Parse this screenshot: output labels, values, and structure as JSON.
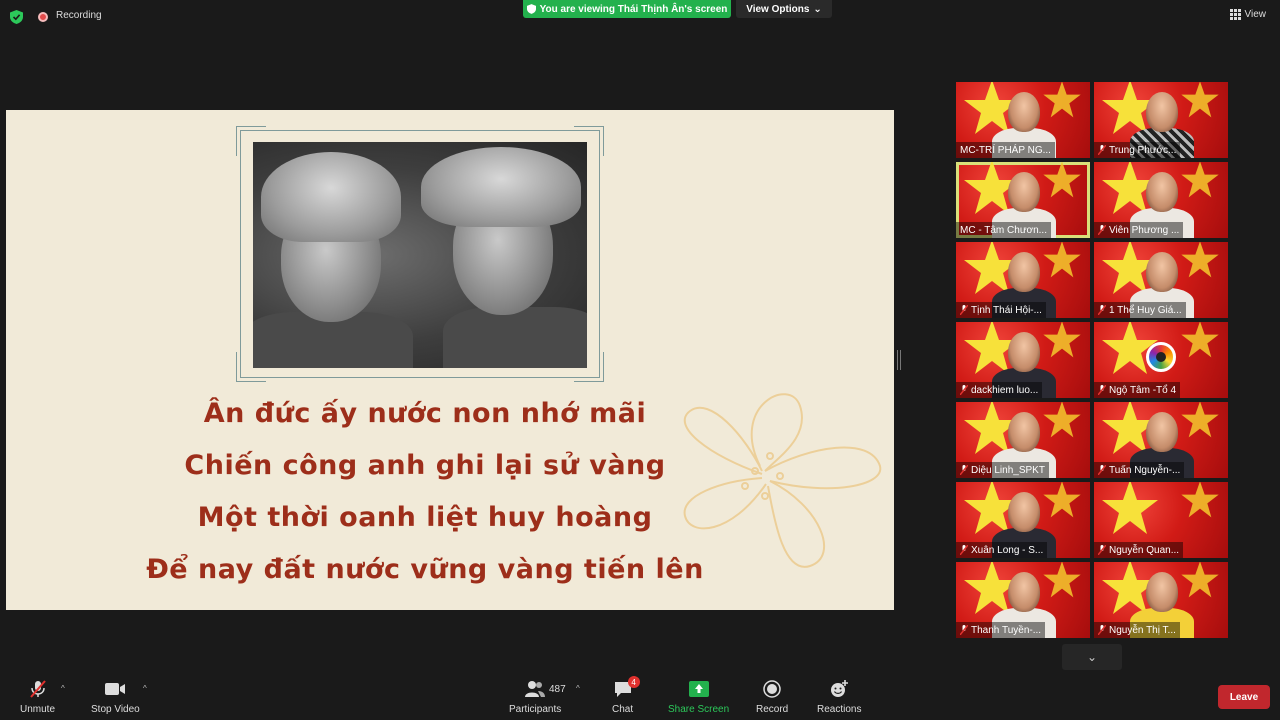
{
  "topbar": {
    "recording_label": "Recording",
    "viewing_banner": "You are viewing Thái Thịnh Ân's screen",
    "view_options_label": "View Options",
    "view_label": "View"
  },
  "slide": {
    "poem_lines": [
      "Ân đức ấy nước non nhớ mãi",
      "Chiến công anh ghi lại sử vàng",
      "Một thời oanh liệt huy hoàng",
      "Để nay đất nước vững vàng tiến lên"
    ],
    "text_color": "#9d2e1a",
    "background_color": "#f1ead8"
  },
  "gallery": {
    "participants": [
      {
        "name": "MC-TRÍ PHÁP NG...",
        "muted": false,
        "active": false
      },
      {
        "name": "Trung Phước...",
        "muted": true,
        "active": false
      },
      {
        "name": "MC - Tâm Chươn...",
        "muted": false,
        "active": true
      },
      {
        "name": "Viên Phương ...",
        "muted": true,
        "active": false
      },
      {
        "name": "Tịnh Thái Hội-...",
        "muted": true,
        "active": false
      },
      {
        "name": "1 Thể Huy Giá...",
        "muted": true,
        "active": false
      },
      {
        "name": "dackhiem luo...",
        "muted": true,
        "active": false
      },
      {
        "name": "Ngộ Tâm -Tổ 4",
        "muted": true,
        "active": false
      },
      {
        "name": "Diệu Linh_SPKT",
        "muted": true,
        "active": false
      },
      {
        "name": "Tuấn Nguyễn-...",
        "muted": true,
        "active": false
      },
      {
        "name": "Xuân Long - S...",
        "muted": true,
        "active": false
      },
      {
        "name": "Nguyễn Quan...",
        "muted": true,
        "active": false
      },
      {
        "name": "Thanh Tuyền-...",
        "muted": true,
        "active": false
      },
      {
        "name": "Nguyễn Thị T...",
        "muted": true,
        "active": false
      }
    ]
  },
  "toolbar": {
    "unmute_label": "Unmute",
    "stop_video_label": "Stop Video",
    "participants_label": "Participants",
    "participants_count": "487",
    "chat_label": "Chat",
    "chat_badge": "4",
    "share_screen_label": "Share Screen",
    "record_label": "Record",
    "reactions_label": "Reactions",
    "leave_label": "Leave"
  },
  "colors": {
    "share_green": "#23b14d",
    "leave_red": "#c1272d",
    "active_speaker": "#d9e07a"
  }
}
